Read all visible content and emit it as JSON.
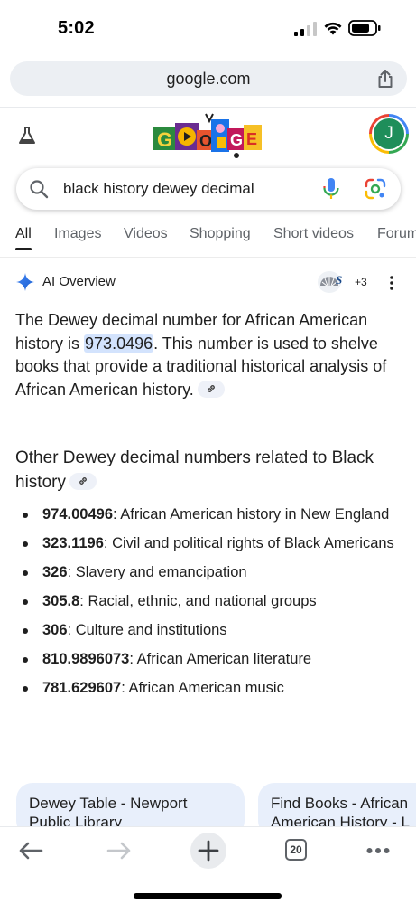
{
  "status": {
    "time": "5:02"
  },
  "browser": {
    "url": "google.com",
    "tab_count": "20"
  },
  "user": {
    "avatar_initial": "J"
  },
  "search": {
    "query": "black history dewey decimal"
  },
  "tabs": [
    {
      "label": "All",
      "active": true
    },
    {
      "label": "Images"
    },
    {
      "label": "Videos"
    },
    {
      "label": "Shopping"
    },
    {
      "label": "Short videos"
    },
    {
      "label": "Forums"
    }
  ],
  "ai_overview": {
    "title": "AI Overview",
    "source_count": "+3",
    "source_logo_text": "S",
    "summary_pre": "The Dewey decimal number for African American history is ",
    "summary_highlight": "973.0496",
    "summary_post": ". This number is used to shelve books that provide a traditional historical analysis of African American history.",
    "subheading": "Other Dewey decimal numbers related to Black history",
    "items": [
      {
        "number": "974.00496",
        "text": ": African American history in New England"
      },
      {
        "number": "323.1196",
        "text": ": Civil and political rights of Black Americans"
      },
      {
        "number": "326",
        "text": ": Slavery and emancipation"
      },
      {
        "number": "305.8",
        "text": ": Racial, ethnic, and national groups"
      },
      {
        "number": "306",
        "text": ": Culture and institutions"
      },
      {
        "number": "810.9896073",
        "text": ": African American literature"
      },
      {
        "number": "781.629607",
        "text": ": African American music"
      }
    ]
  },
  "source_cards": [
    {
      "title_line1": "Dewey Table - Newport",
      "title_line2": "Public Library"
    },
    {
      "title_line1": "Find Books - African",
      "title_line2": "American History - L"
    }
  ],
  "icons": {
    "labs": "flask-icon",
    "share": "share-icon",
    "search": "search-icon",
    "mic": "microphone-icon",
    "lens": "google-lens-icon",
    "ai": "sparkle-icon",
    "more": "more-vert-icon",
    "link": "link-icon",
    "back": "arrow-back-icon",
    "forward": "arrow-forward-icon",
    "new_tab": "plus-icon",
    "menu": "more-horiz-icon"
  },
  "colors": {
    "accent_blue": "#4285f4",
    "highlight": "#d3e3fd",
    "card_bg": "#e8effb",
    "avatar_bg": "#1e8e5a"
  }
}
